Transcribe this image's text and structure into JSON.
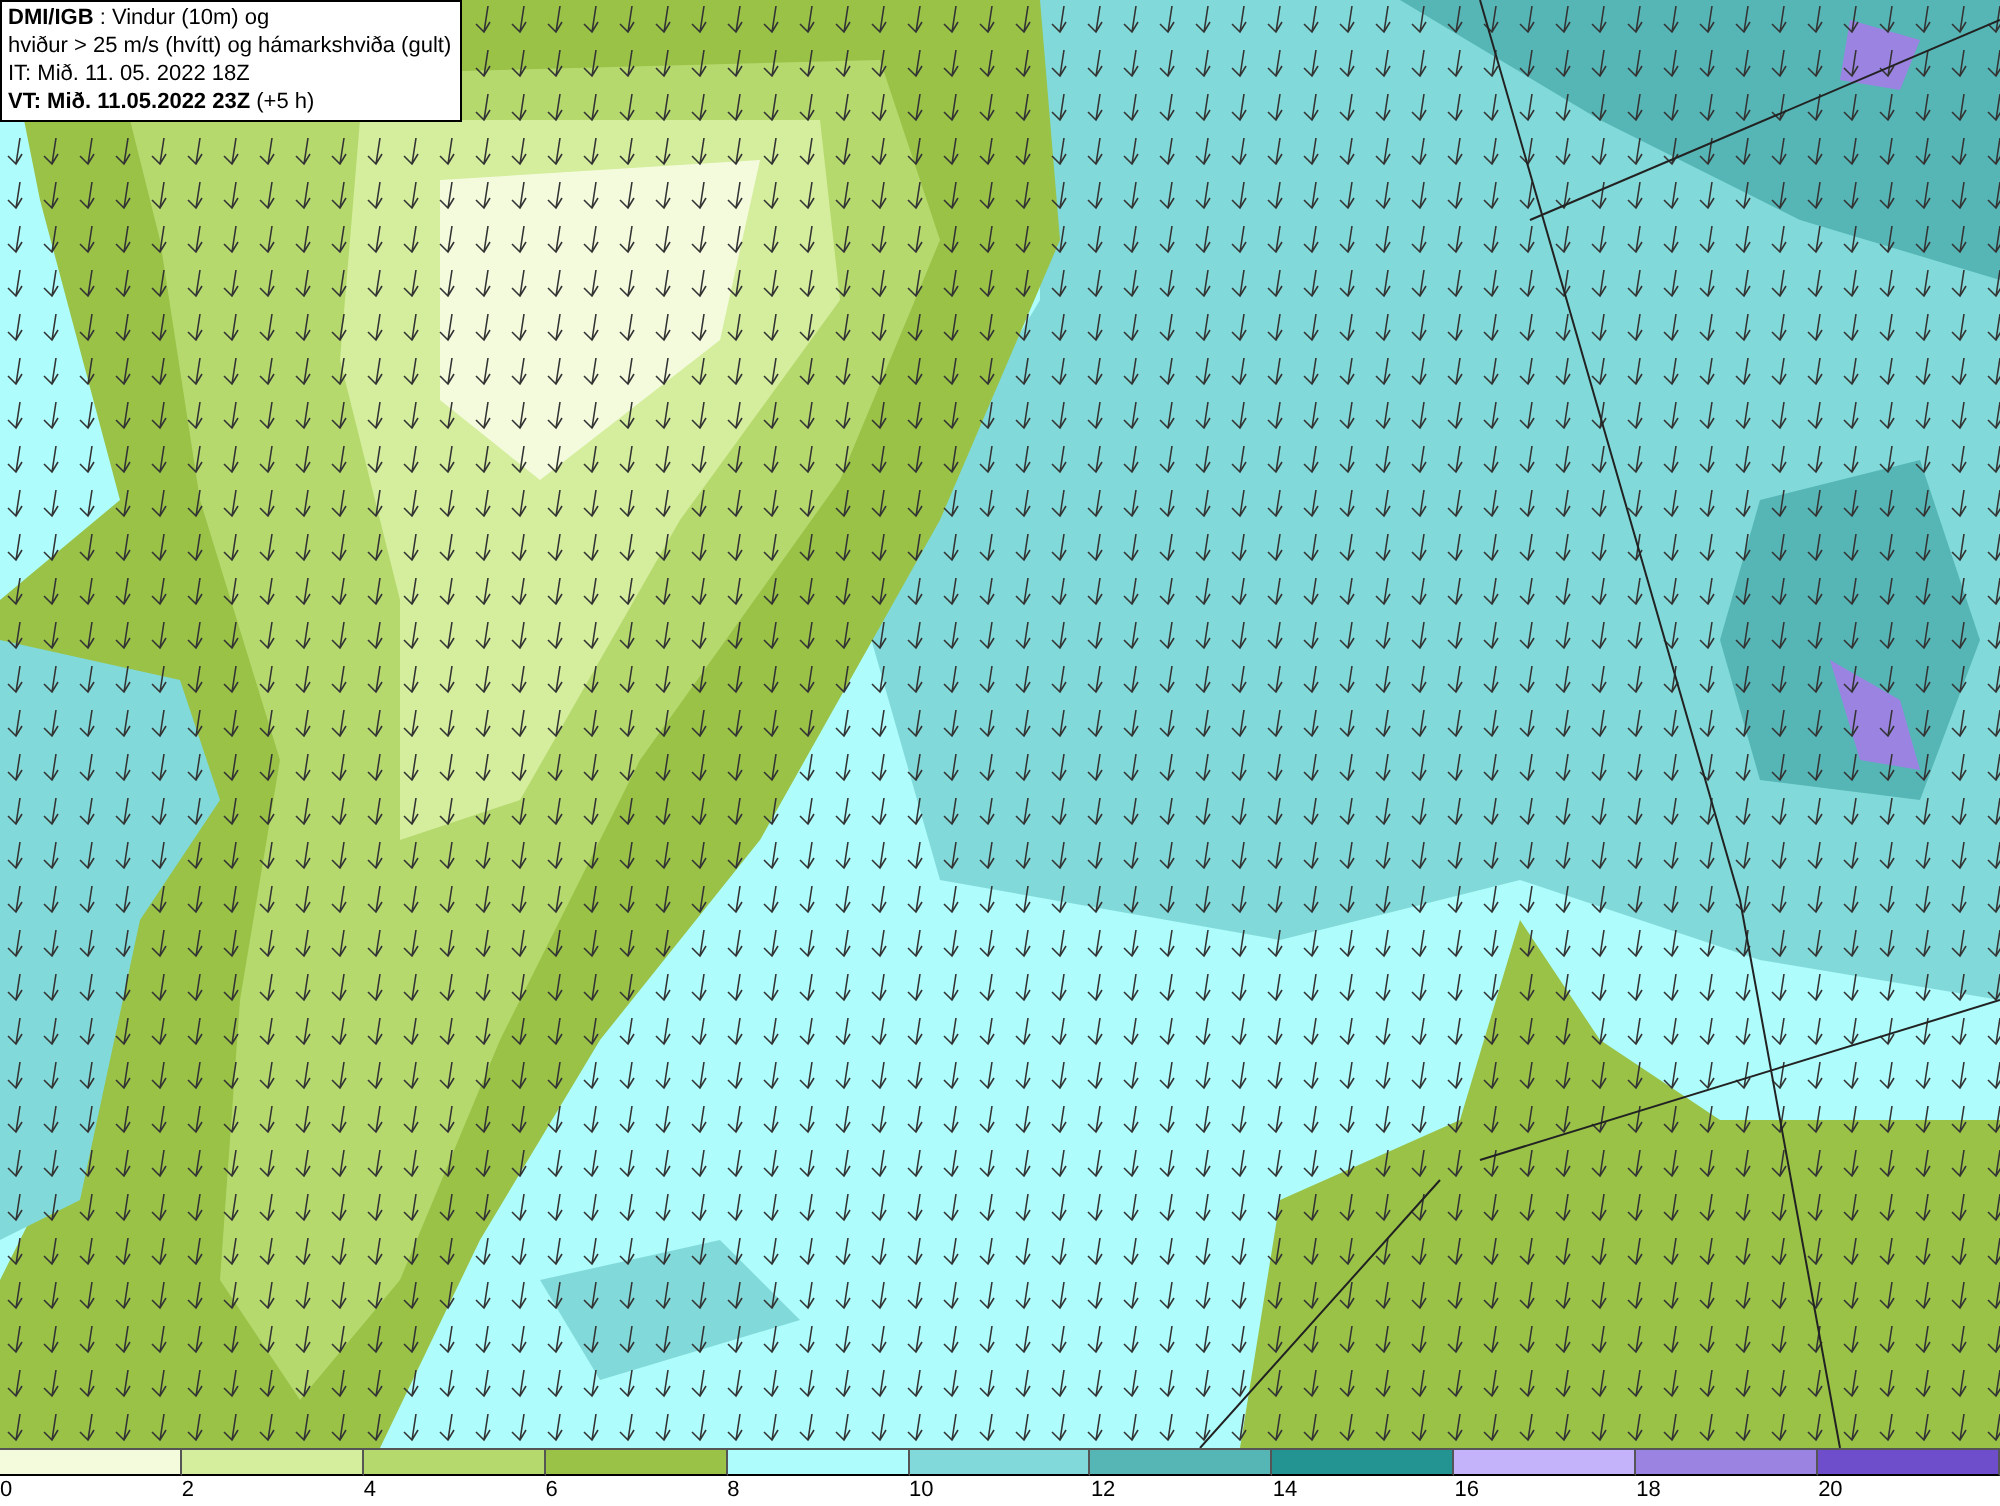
{
  "legend": {
    "lines": [
      "**DMI/IGB** : Vindur (10m) og",
      "hviður > 25 m/s (hvítt) og hámarkshviða (gult)",
      "IT: Mið. 11. 05. 2022 18Z",
      "**VT: Mið. 11.05.2022 23Z** (+5 h)"
    ]
  },
  "colorbar": {
    "segments": [
      {
        "color": "#f4fbdd",
        "label": "0"
      },
      {
        "color": "#d5ee9d",
        "label": "2"
      },
      {
        "color": "#b6d96e",
        "label": "4"
      },
      {
        "color": "#99c247",
        "label": "6"
      },
      {
        "color": "#aefcfc",
        "label": "8"
      },
      {
        "color": "#81dad9",
        "label": "10"
      },
      {
        "color": "#56b6b6",
        "label": "12"
      },
      {
        "color": "#239491",
        "label": "14"
      },
      {
        "color": "#c4b2fb",
        "label": "16"
      },
      {
        "color": "#9b83e1",
        "label": "18"
      },
      {
        "color": "#6e4eca",
        "label": "20"
      }
    ]
  }
}
